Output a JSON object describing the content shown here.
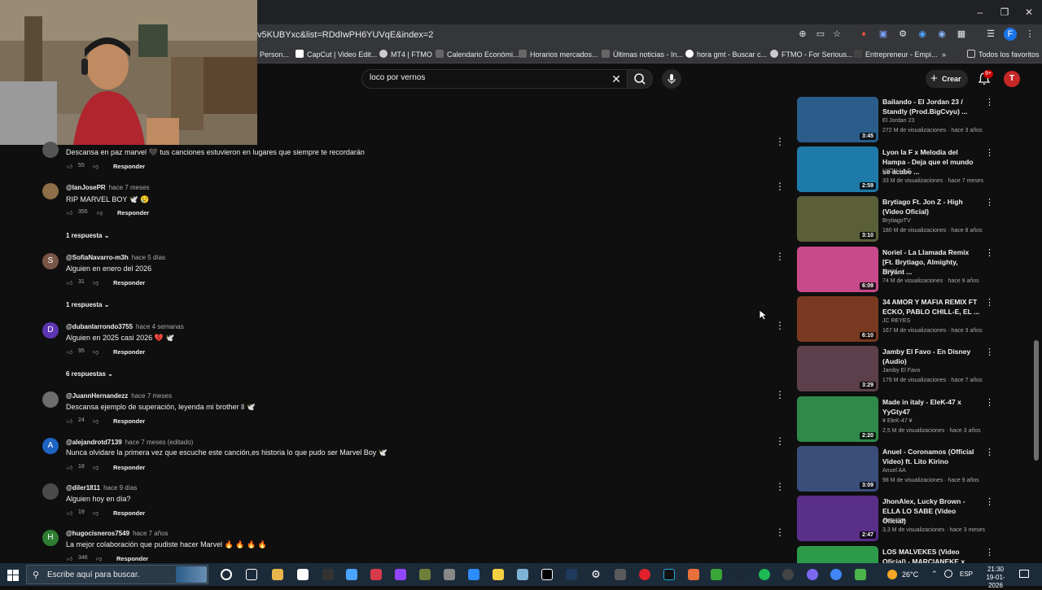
{
  "browser": {
    "url": "v5KUBYxc&list=RDdIwPH6YUVqE&index=2",
    "bookmarks": [
      "Person...",
      "CapCut | Video Edit...",
      "MT4 | FTMO",
      "Calendario Económi...",
      "Horarios mercados...",
      "Últimas noticias - In...",
      "hora gmt - Buscar c...",
      "FTMO - For Serious...",
      "Entrepreneur - Empi..."
    ],
    "all_bookmarks": "Todos los favoritos",
    "profile_initial": "F"
  },
  "youtube": {
    "search_value": "loco por vernos",
    "create_label": "Crear",
    "notif_count": "9+",
    "avatar_initial": "T"
  },
  "comments": [
    {
      "author": "",
      "time": "",
      "text": "Descansa en paz marvel 🖤 tus  canciones estuvieron en lugares que siempre te recordarán",
      "likes": "55",
      "reply": "Responder",
      "replies": "",
      "avatar": "",
      "avatar_color": "#555555"
    },
    {
      "author": "@IanJosePR",
      "time": "hace 7 meses",
      "text": "RIP MARVEL BOY 🕊️ 😢",
      "likes": "355",
      "reply": "Responder",
      "replies": "1 respuesta",
      "avatar": "",
      "avatar_color": "#8d6e47"
    },
    {
      "author": "@SofiaNavarro-m3h",
      "time": "hace 5 días",
      "text": "Alguien en enero del 2026",
      "likes": "31",
      "reply": "Responder",
      "replies": "1 respuesta",
      "avatar": "S",
      "avatar_color": "#795548"
    },
    {
      "author": "@dubanlarrondo3755",
      "time": "hace 4 semanas",
      "text": "Alguien en 2025 casi 2026 💔 🕊️",
      "likes": "95",
      "reply": "Responder",
      "replies": "6 respuestas",
      "avatar": "D",
      "avatar_color": "#5e35b1"
    },
    {
      "author": "@JuannHernandezz",
      "time": "hace 7 meses",
      "text": "Descansa ejemplo de superación, leyenda mi brother ll 🕊️",
      "likes": "24",
      "reply": "Responder",
      "replies": "",
      "avatar": "",
      "avatar_color": "#6d6d6d"
    },
    {
      "author": "@alejandrotd7139",
      "time": "hace 7 meses (editado)",
      "text": "Nunca olvidare la primera vez que escuche este canción,es historia lo que pudo ser Marvel Boy 🕊️",
      "likes": "18",
      "reply": "Responder",
      "replies": "",
      "avatar": "A",
      "avatar_color": "#1e63c4"
    },
    {
      "author": "@diler1811",
      "time": "hace 9 días",
      "text": "Alguien hoy en día?",
      "likes": "19",
      "reply": "Responder",
      "replies": "",
      "avatar": "",
      "avatar_color": "#4a4a4a"
    },
    {
      "author": "@hugocisneros7549",
      "time": "hace 7 años",
      "text": "La mejor colaboración que pudiste hacer Marvel 🔥 🔥 🔥 🔥",
      "likes": "346",
      "reply": "Responder",
      "replies": "",
      "avatar": "H",
      "avatar_color": "#2e7d32"
    }
  ],
  "recommendations": [
    {
      "title": "Bailando - El Jordan 23 / Standly (Prod.BigCvyu) ...",
      "channel": "El Jordan 23",
      "stats": "272 M de visualizaciones · hace 3 años",
      "duration": "3:45",
      "color": "#2a5d8a"
    },
    {
      "title": "Lyon la F x Melodia del Hampa - Deja que el mundo se acabe ...",
      "channel": "LYON LA F",
      "stats": "33 M de visualizaciones · hace 7 meses",
      "duration": "2:59",
      "color": "#1e7aa8"
    },
    {
      "title": "Brytiago Ft. Jon Z - High (Video Oficial)",
      "channel": "BrytiagoTV",
      "stats": "180 M de visualizaciones · hace 8 años",
      "duration": "3:10",
      "color": "#5a5f3a"
    },
    {
      "title": "Noriel - La Llamada Remix [Ft. Brytiago, Almighty, Bryant ...",
      "channel": "Noriel",
      "stats": "74 M de visualizaciones · hace 9 años",
      "duration": "6:09",
      "color": "#c94a8a"
    },
    {
      "title": "34 AMOR Y MAFIA REMIX FT ECKO, PABLO CHILL-E, EL ...",
      "channel": "JC REYES",
      "stats": "167 M de visualizaciones · hace 3 años",
      "duration": "6:10",
      "color": "#7a3a22"
    },
    {
      "title": "Jamby El Favo - En Disney (Audio)",
      "channel": "Jamby El Favo",
      "stats": "179 M de visualizaciones · hace 7 años",
      "duration": "3:29",
      "color": "#5c3f4a"
    },
    {
      "title": "Made in italy - EleK-47 x YyGty47",
      "channel": "¥ EleK-47 ¥",
      "stats": "2,5 M de visualizaciones · hace 3 años",
      "duration": "2:20",
      "color": "#2f8a4a"
    },
    {
      "title": "Anuel - Coronamos (Official Video) ft. Lito Kirino",
      "channel": "Anuel AA",
      "stats": "98 M de visualizaciones · hace 9 años",
      "duration": "3:09",
      "color": "#3b4e7a"
    },
    {
      "title": "JhonAlex, Lucky Brown - ELLA LO SABE (Video Oficial)",
      "channel": "Jhonalex",
      "stats": "3,3 M de visualizaciones · hace 3 meses",
      "duration": "2:47",
      "color": "#5a2f8a"
    },
    {
      "title": "LOS MALVEKES (Video Oficial) - MARCIANEKE x CRIS MJ x ...",
      "channel": "",
      "stats": "",
      "duration": "",
      "color": "#2d9a4a"
    }
  ],
  "taskbar": {
    "search_placeholder": "Escribe aquí para buscar.",
    "temperature": "26°C",
    "language": "ESP",
    "time": "21:30",
    "date": "19-01-2026"
  }
}
